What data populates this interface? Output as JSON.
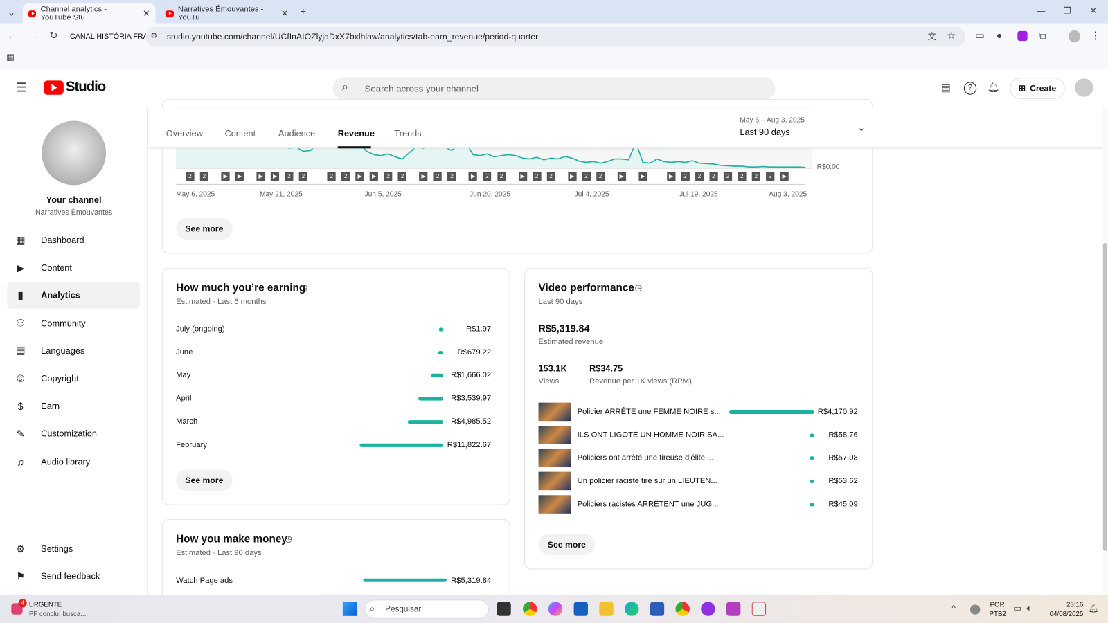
{
  "browser": {
    "tabs": [
      {
        "title": "Channel analytics - YouTube Stu",
        "active": true
      },
      {
        "title": "Narratives Émouvantes - YouTu",
        "active": false
      }
    ],
    "profile_label": "CANAL HISTÓRIA FRA",
    "url": "studio.youtube.com/channel/UCfInAIOZlyjaDxX7bxlhlaw/analytics/tab-earn_revenue/period-quarter"
  },
  "header": {
    "logo": "Studio",
    "search_placeholder": "Search across your channel",
    "create_label": "Create"
  },
  "sidebar": {
    "channel_title": "Your channel",
    "channel_name": "Narratives Émouvantes",
    "items": [
      {
        "label": "Dashboard",
        "icon": "dashboard-icon"
      },
      {
        "label": "Content",
        "icon": "content-icon"
      },
      {
        "label": "Analytics",
        "icon": "analytics-icon",
        "selected": true
      },
      {
        "label": "Community",
        "icon": "community-icon"
      },
      {
        "label": "Languages",
        "icon": "languages-icon"
      },
      {
        "label": "Copyright",
        "icon": "copyright-icon"
      },
      {
        "label": "Earn",
        "icon": "earn-icon"
      },
      {
        "label": "Customization",
        "icon": "customization-icon"
      },
      {
        "label": "Audio library",
        "icon": "audio-library-icon"
      }
    ],
    "bottom": [
      {
        "label": "Settings"
      },
      {
        "label": "Send feedback"
      }
    ]
  },
  "tabs": [
    "Overview",
    "Content",
    "Audience",
    "Revenue",
    "Trends"
  ],
  "date_range": {
    "range": "May 6 – Aug 3, 2025",
    "label": "Last 90 days"
  },
  "chart_data": {
    "type": "area",
    "title": "Estimated revenue",
    "x_ticks": [
      "May 6, 2025",
      "May 21, 2025",
      "Jun 5, 2025",
      "Jun 20, 2025",
      "Jul 4, 2025",
      "Jul 19, 2025",
      "Aug 3, 2025"
    ],
    "y_tick_visible": "R$0.00",
    "values": [
      120,
      110,
      105,
      100,
      95,
      98,
      90,
      85,
      88,
      80,
      78,
      75,
      72,
      60,
      50,
      58,
      45,
      48,
      38,
      40,
      55,
      50,
      60,
      70,
      62,
      65,
      55,
      38,
      30,
      28,
      32,
      25,
      20,
      35,
      50,
      45,
      60,
      55,
      48,
      40,
      55,
      58,
      30,
      28,
      32,
      25,
      28,
      30,
      28,
      22,
      20,
      24,
      18,
      22,
      20,
      26,
      22,
      15,
      12,
      14,
      10,
      14,
      20,
      20,
      18,
      60,
      12,
      10,
      20,
      14,
      12,
      14,
      12,
      16,
      10,
      9,
      8,
      5,
      4,
      3,
      3,
      1,
      1,
      2,
      1,
      1,
      1,
      1,
      1,
      0
    ],
    "ylim": [
      0,
      50
    ],
    "markers": [
      [
        2,
        "2"
      ],
      [
        4,
        "2"
      ],
      [
        7,
        "v"
      ],
      [
        9,
        "v"
      ],
      [
        12,
        "v"
      ],
      [
        14,
        "v"
      ],
      [
        16,
        "2"
      ],
      [
        18,
        "2"
      ],
      [
        22,
        "2"
      ],
      [
        24,
        "2"
      ],
      [
        26,
        "v"
      ],
      [
        28,
        "v"
      ],
      [
        30,
        "2"
      ],
      [
        32,
        "2"
      ],
      [
        35,
        "v"
      ],
      [
        37,
        "2"
      ],
      [
        39,
        "2"
      ],
      [
        42,
        "v"
      ],
      [
        44,
        "2"
      ],
      [
        46,
        "2"
      ],
      [
        49,
        "v"
      ],
      [
        51,
        "2"
      ],
      [
        53,
        "2"
      ],
      [
        56,
        "v"
      ],
      [
        58,
        "2"
      ],
      [
        60,
        "2"
      ],
      [
        63,
        "v"
      ],
      [
        66,
        "v"
      ],
      [
        70,
        "v"
      ],
      [
        72,
        "2"
      ],
      [
        74,
        "2"
      ],
      [
        76,
        "2"
      ],
      [
        78,
        "2"
      ],
      [
        80,
        "2"
      ],
      [
        82,
        "2"
      ],
      [
        84,
        "2"
      ],
      [
        86,
        "v"
      ]
    ]
  },
  "see_more": "See more",
  "earning": {
    "title": "How much you’re earning",
    "subtitle": "Estimated · Last 6 months",
    "rows": [
      {
        "label": "July (ongoing)",
        "value": "R$1.97",
        "amount": 1.97
      },
      {
        "label": "June",
        "value": "R$679.22",
        "amount": 679.22
      },
      {
        "label": "May",
        "value": "R$1,666.02",
        "amount": 1666.02
      },
      {
        "label": "April",
        "value": "R$3,539.97",
        "amount": 3539.97
      },
      {
        "label": "March",
        "value": "R$4,985.52",
        "amount": 4985.52
      },
      {
        "label": "February",
        "value": "R$11,822.67",
        "amount": 11822.67
      }
    ]
  },
  "make_money": {
    "title": "How you make money",
    "subtitle": "Estimated · Last 90 days",
    "rows": [
      {
        "label": "Watch Page ads",
        "value": "R$5,319.84",
        "amount": 5319.84
      }
    ]
  },
  "video_perf": {
    "title": "Video performance",
    "subtitle": "Last 90 days",
    "revenue": "R$5,319.84",
    "revenue_label": "Estimated revenue",
    "views": "153.1K",
    "views_label": "Views",
    "rpm": "R$34.75",
    "rpm_label": "Revenue per 1K views (RPM)",
    "videos": [
      {
        "title": "Policier ARRÊTE une FEMME NOIRE s...",
        "value": "R$4,170.92",
        "amount": 4170.92
      },
      {
        "title": "ILS ONT LIGOTÉ UN HOMME NOIR SA...",
        "value": "R$58.76",
        "amount": 58.76
      },
      {
        "title": "Policiers ont arrêté une tireuse d'élite ...",
        "value": "R$57.08",
        "amount": 57.08
      },
      {
        "title": "Un policier raciste tire sur un LIEUTEN...",
        "value": "R$53.62",
        "amount": 53.62
      },
      {
        "title": "Policiers racistes ARRÊTENT une JUG...",
        "value": "R$45.09",
        "amount": 45.09
      }
    ]
  },
  "taskbar": {
    "news_badge": "4",
    "news_title": "URGENTE",
    "news_sub": "PF concluí busca...",
    "search": "Pesquisar",
    "lang": "POR",
    "lang2": "PTB2",
    "time": "23:16",
    "date": "04/08/2025"
  },
  "colors": {
    "accent": "#1db2a0",
    "yt_red": "#ff0000"
  }
}
